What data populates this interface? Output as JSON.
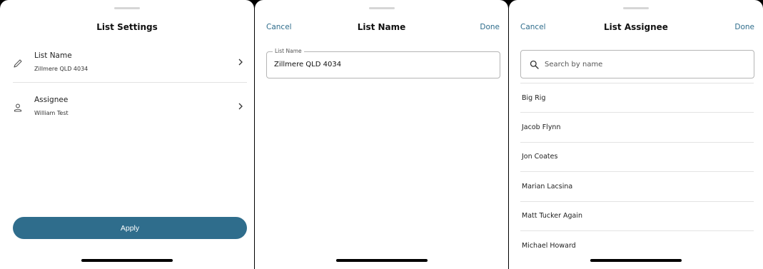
{
  "settings_sheet": {
    "title": "List Settings",
    "rows": [
      {
        "label": "List Name",
        "value": "Zillmere QLD 4034",
        "icon": "pencil-icon"
      },
      {
        "label": "Assignee",
        "value": "William Test",
        "icon": "person-icon"
      }
    ],
    "apply_label": "Apply"
  },
  "name_sheet": {
    "cancel_label": "Cancel",
    "title": "List Name",
    "done_label": "Done",
    "field_label": "List Name",
    "field_value": "Zillmere QLD 4034"
  },
  "assignee_sheet": {
    "cancel_label": "Cancel",
    "title": "List Assignee",
    "done_label": "Done",
    "search_placeholder": "Search by name",
    "people": [
      "Big Rig",
      "Jacob Flynn",
      "Jon Coates",
      "Marian Lacsina",
      "Matt Tucker Again",
      "Michael Howard"
    ]
  },
  "colors": {
    "accent": "#2f6d8c",
    "background": "#ffffff",
    "divider": "#e3e3e3"
  }
}
